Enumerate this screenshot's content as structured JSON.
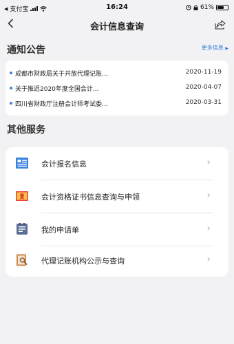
{
  "status_bar": {
    "carrier": "支付宝",
    "time": "16:24",
    "battery": "61%",
    "battery_level": 0.61
  },
  "nav": {
    "title": "会计信息查询",
    "back_icon": "chevron-left-icon",
    "share_icon": "share-icon"
  },
  "notices": {
    "section_title": "通知公告",
    "more_label": "更多信息",
    "items": [
      {
        "title": "成都市财政局关于开放代理记账...",
        "date": "2020-11-19"
      },
      {
        "title": "关于推迟2020年度全国会计...",
        "date": "2020-04-07"
      },
      {
        "title": "四川省财政厅注册会计师考试委...",
        "date": "2020-03-31"
      }
    ]
  },
  "services": {
    "section_title": "其他服务",
    "items": [
      {
        "label": "会计报名信息",
        "icon": "id-card-icon"
      },
      {
        "label": "会计资格证书信息查询与申领",
        "icon": "certificate-icon"
      },
      {
        "label": "我的申请单",
        "icon": "application-form-icon"
      },
      {
        "label": "代理记账机构公示与查询",
        "icon": "agency-search-icon"
      }
    ]
  },
  "colors": {
    "accent": "#2f7bd6",
    "background": "#f2f2f4"
  }
}
